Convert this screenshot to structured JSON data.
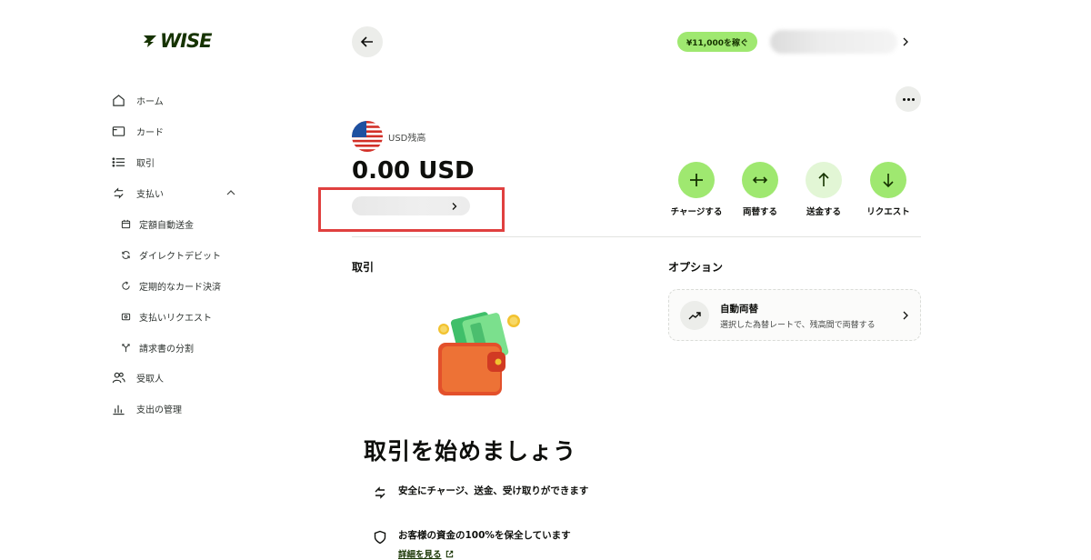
{
  "brand": {
    "logo_text": "WISE"
  },
  "sidebar": {
    "items": [
      {
        "label": "ホーム",
        "icon": "home-icon"
      },
      {
        "label": "カード",
        "icon": "card-icon"
      },
      {
        "label": "取引",
        "icon": "list-icon"
      },
      {
        "label": "支払い",
        "icon": "payments-icon",
        "expanded": true
      },
      {
        "label": "受取人",
        "icon": "recipients-icon"
      },
      {
        "label": "支出の管理",
        "icon": "chart-icon"
      }
    ],
    "payments_sub": [
      {
        "label": "定額自動送金",
        "icon": "calendar-icon"
      },
      {
        "label": "ダイレクトデビット",
        "icon": "refresh-icon"
      },
      {
        "label": "定期的なカード決済",
        "icon": "repeat-icon"
      },
      {
        "label": "支払いリクエスト",
        "icon": "request-icon"
      },
      {
        "label": "請求書の分割",
        "icon": "split-icon"
      }
    ]
  },
  "header": {
    "earn_badge": "¥11,000を稼ぐ"
  },
  "balance": {
    "label": "USD残高",
    "amount": "0.00 USD"
  },
  "actions": [
    {
      "label": "チャージする",
      "icon": "plus-icon"
    },
    {
      "label": "両替する",
      "icon": "swap-icon"
    },
    {
      "label": "送金する",
      "icon": "arrow-up-icon"
    },
    {
      "label": "リクエスト",
      "icon": "arrow-down-icon"
    }
  ],
  "sections": {
    "transactions_title": "取引",
    "options_title": "オプション"
  },
  "option_card": {
    "title": "自動両替",
    "description": "選択した為替レートで、残高間で両替する"
  },
  "empty_state": {
    "heading": "取引を始めましょう",
    "features": [
      "安全にチャージ、送金、受け取りができます",
      "お客様の資金の100%を保全しています"
    ],
    "details_link": "詳細を見る"
  },
  "colors": {
    "accent": "#9fe870",
    "accent_light": "#e2f6d5",
    "brand_dark": "#163300",
    "highlight": "#e0403f"
  }
}
